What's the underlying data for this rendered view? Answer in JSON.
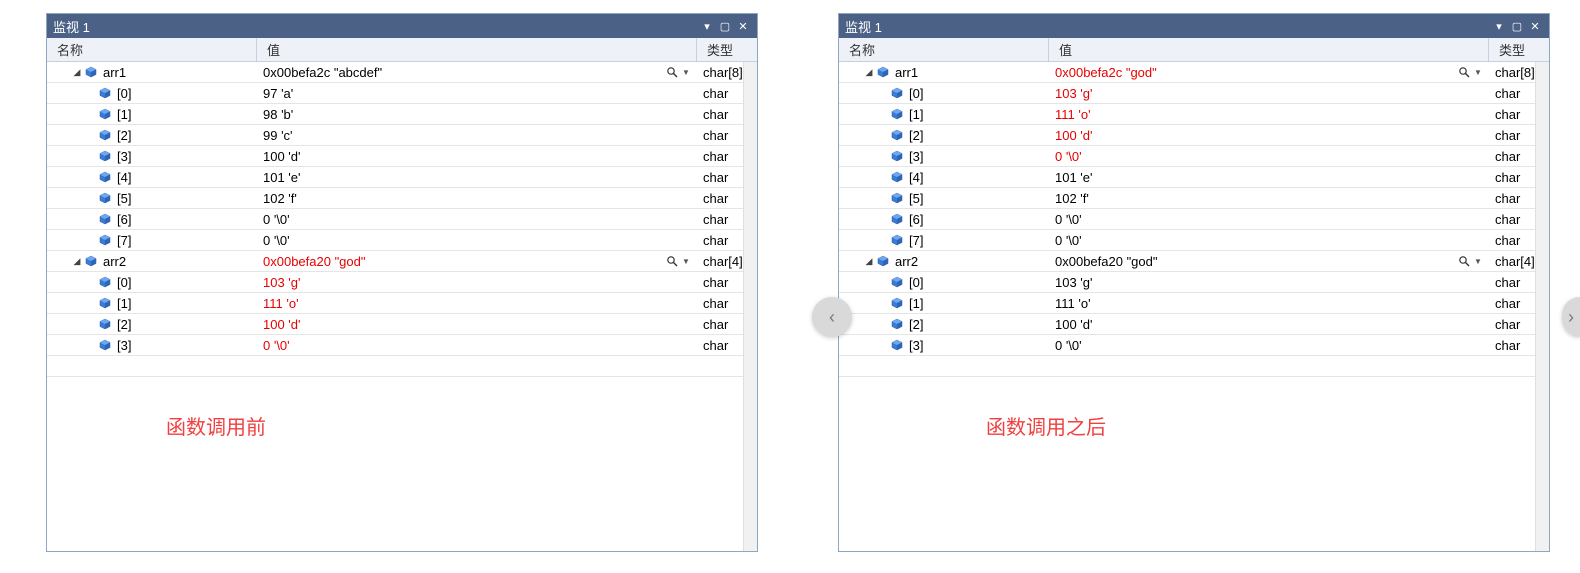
{
  "nav": {
    "prev_glyph": "‹",
    "next_glyph": "›"
  },
  "panels": [
    {
      "title": "监视 1",
      "headers": {
        "name": "名称",
        "value": "值",
        "type": "类型"
      },
      "caption": "函数调用前",
      "rows": [
        {
          "kind": "parent",
          "name": "arr1",
          "value": "0x00befa2c \"abcdef\"",
          "type": "char[8]",
          "red": false,
          "lookup": true
        },
        {
          "kind": "child",
          "name": "[0]",
          "value": "97 'a'",
          "type": "char",
          "red": false
        },
        {
          "kind": "child",
          "name": "[1]",
          "value": "98 'b'",
          "type": "char",
          "red": false
        },
        {
          "kind": "child",
          "name": "[2]",
          "value": "99 'c'",
          "type": "char",
          "red": false
        },
        {
          "kind": "child",
          "name": "[3]",
          "value": "100 'd'",
          "type": "char",
          "red": false
        },
        {
          "kind": "child",
          "name": "[4]",
          "value": "101 'e'",
          "type": "char",
          "red": false
        },
        {
          "kind": "child",
          "name": "[5]",
          "value": "102 'f'",
          "type": "char",
          "red": false
        },
        {
          "kind": "child",
          "name": "[6]",
          "value": "0 '\\0'",
          "type": "char",
          "red": false
        },
        {
          "kind": "child",
          "name": "[7]",
          "value": "0 '\\0'",
          "type": "char",
          "red": false
        },
        {
          "kind": "parent",
          "name": "arr2",
          "value": "0x00befa20 \"god\"",
          "type": "char[4]",
          "red": true,
          "lookup": true
        },
        {
          "kind": "child",
          "name": "[0]",
          "value": "103 'g'",
          "type": "char",
          "red": true
        },
        {
          "kind": "child",
          "name": "[1]",
          "value": "111 'o'",
          "type": "char",
          "red": true
        },
        {
          "kind": "child",
          "name": "[2]",
          "value": "100 'd'",
          "type": "char",
          "red": true
        },
        {
          "kind": "child",
          "name": "[3]",
          "value": "0 '\\0'",
          "type": "char",
          "red": true
        }
      ]
    },
    {
      "title": "监视 1",
      "headers": {
        "name": "名称",
        "value": "值",
        "type": "类型"
      },
      "caption": "函数调用之后",
      "rows": [
        {
          "kind": "parent",
          "name": "arr1",
          "value": "0x00befa2c \"god\"",
          "type": "char[8]",
          "red": true,
          "lookup": true
        },
        {
          "kind": "child",
          "name": "[0]",
          "value": "103 'g'",
          "type": "char",
          "red": true
        },
        {
          "kind": "child",
          "name": "[1]",
          "value": "111 'o'",
          "type": "char",
          "red": true
        },
        {
          "kind": "child",
          "name": "[2]",
          "value": "100 'd'",
          "type": "char",
          "red": true
        },
        {
          "kind": "child",
          "name": "[3]",
          "value": "0 '\\0'",
          "type": "char",
          "red": true
        },
        {
          "kind": "child",
          "name": "[4]",
          "value": "101 'e'",
          "type": "char",
          "red": false
        },
        {
          "kind": "child",
          "name": "[5]",
          "value": "102 'f'",
          "type": "char",
          "red": false
        },
        {
          "kind": "child",
          "name": "[6]",
          "value": "0 '\\0'",
          "type": "char",
          "red": false
        },
        {
          "kind": "child",
          "name": "[7]",
          "value": "0 '\\0'",
          "type": "char",
          "red": false
        },
        {
          "kind": "parent",
          "name": "arr2",
          "value": "0x00befa20 \"god\"",
          "type": "char[4]",
          "red": false,
          "lookup": true
        },
        {
          "kind": "child",
          "name": "[0]",
          "value": "103 'g'",
          "type": "char",
          "red": false
        },
        {
          "kind": "child",
          "name": "[1]",
          "value": "111 'o'",
          "type": "char",
          "red": false
        },
        {
          "kind": "child",
          "name": "[2]",
          "value": "100 'd'",
          "type": "char",
          "red": false
        },
        {
          "kind": "child",
          "name": "[3]",
          "value": "0 '\\0'",
          "type": "char",
          "red": false
        }
      ]
    }
  ]
}
